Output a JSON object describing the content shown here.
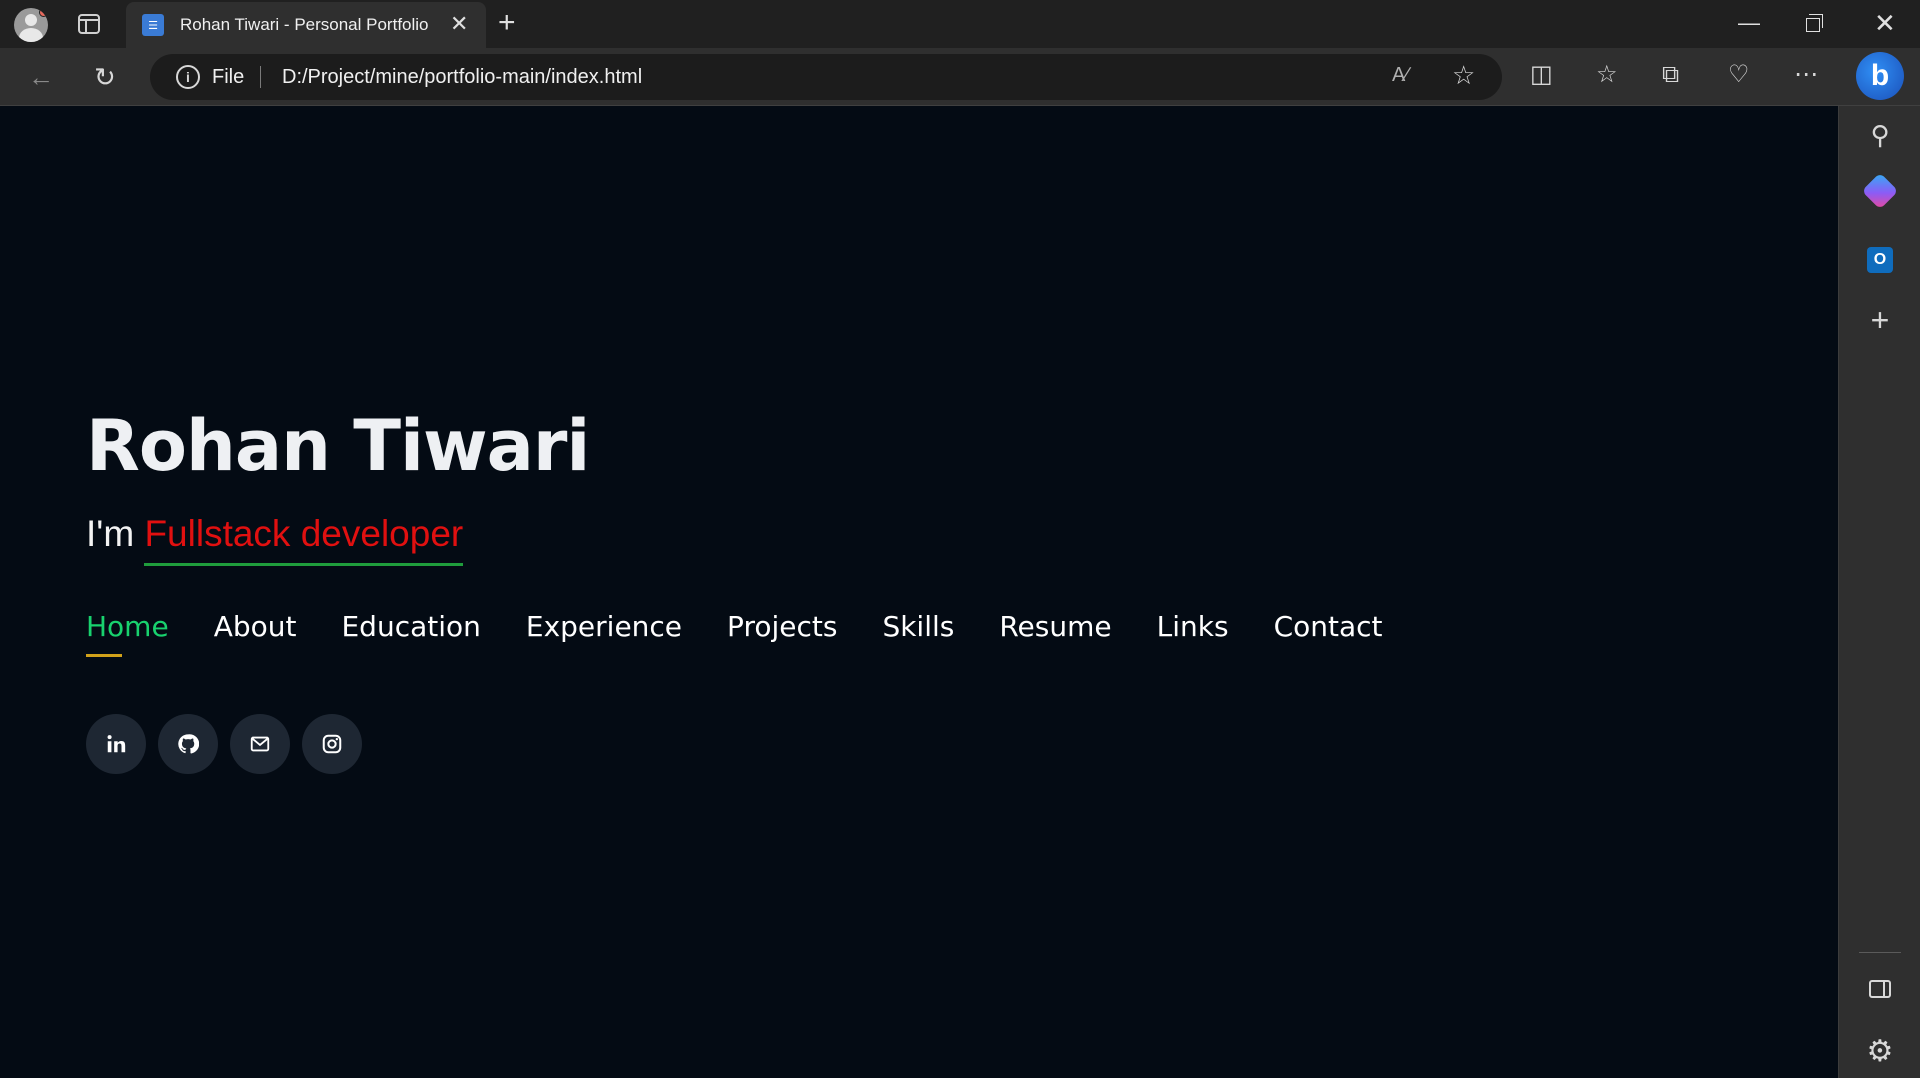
{
  "browser": {
    "tab_title": "Rohan Tiwari - Personal Portfolio",
    "address_scheme": "File",
    "address_url": "D:/Project/mine/portfolio-main/index.html"
  },
  "hero": {
    "name": "Rohan Tiwari",
    "intro": "I'm",
    "role": "Fullstack developer"
  },
  "nav": {
    "items": [
      {
        "label": "Home",
        "active": true
      },
      {
        "label": "About"
      },
      {
        "label": "Education"
      },
      {
        "label": "Experience"
      },
      {
        "label": "Projects"
      },
      {
        "label": "Skills"
      },
      {
        "label": "Resume"
      },
      {
        "label": "Links"
      },
      {
        "label": "Contact"
      }
    ]
  },
  "social": {
    "icons": [
      "linkedin-icon",
      "github-icon",
      "mail-icon",
      "instagram-icon"
    ]
  },
  "colors": {
    "page_bg": "#040b14",
    "nav_active": "#18d26e",
    "role_text": "#e01010",
    "role_underline": "#1f9d3c",
    "nav_underline": "#d2a21a",
    "social_bg": "#1e2733"
  }
}
